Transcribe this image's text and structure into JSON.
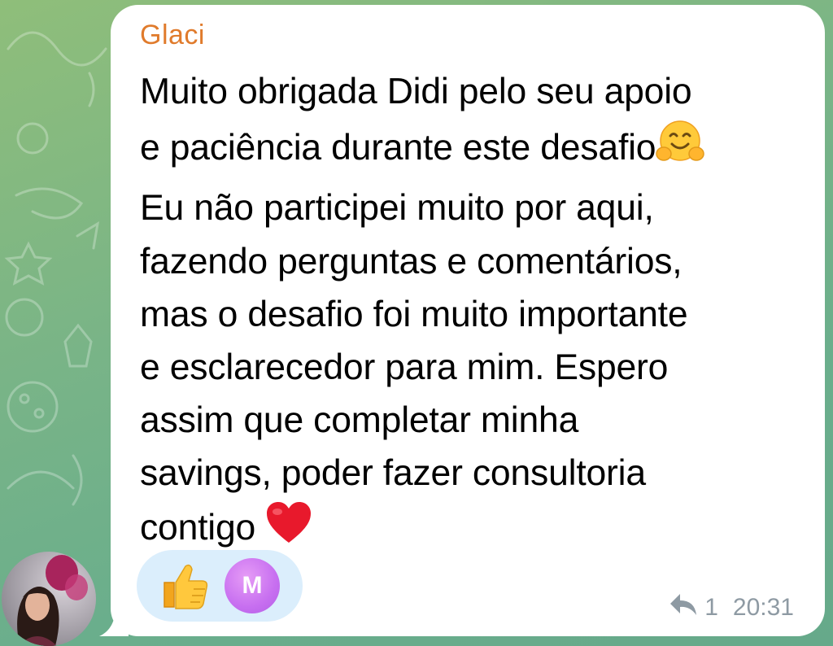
{
  "message": {
    "sender": "Glaci",
    "lines": [
      "Muito obrigada Didi pelo seu apoio",
      "e paciência durante este desafio",
      "Eu não participei muito por aqui,",
      "fazendo perguntas e comentários,",
      "mas o desafio foi muito importante",
      "e esclarecedor para mim. Espero",
      "assim que completar minha",
      "savings, poder fazer consultoria",
      "contigo"
    ],
    "reply_count": "1",
    "time": "20:31"
  },
  "reactions": {
    "thumb_icon": "thumbs-up-emoji",
    "reactor_initial": "M",
    "reactor_color": "#c76ff0"
  },
  "colors": {
    "sender": "#e07b2c",
    "bubble": "#ffffff",
    "reaction_pill": "#dbeefc",
    "meta": "#8e9aa3"
  }
}
